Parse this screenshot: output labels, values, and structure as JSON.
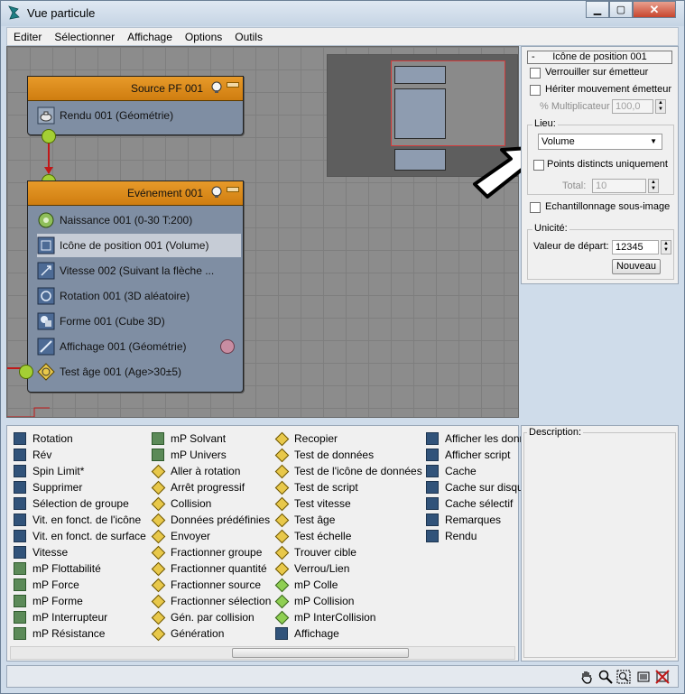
{
  "window": {
    "title": "Vue particule",
    "minimize": "▁",
    "maximize": "▢",
    "close": "✕"
  },
  "menu": [
    "Editer",
    "Sélectionner",
    "Affichage",
    "Options",
    "Outils"
  ],
  "source_node": {
    "title": "Source PF 001",
    "operator": "Rendu 001 (Géométrie)"
  },
  "event_node": {
    "title": "Evénement 001",
    "operators": [
      "Naissance 001 (0-30 T:200)",
      "Icône de position 001 (Volume)",
      "Vitesse 002 (Suivant la flèche ...",
      "Rotation 001 (3D aléatoire)",
      "Forme 001 (Cube 3D)",
      "Affichage 001 (Géométrie)",
      "Test âge 001 (Age>30±5)"
    ],
    "selected_index": 1
  },
  "rollout": {
    "collapse": "-",
    "title": "Icône de position 001",
    "lock_emitter": "Verrouiller sur émetteur",
    "inherit_motion": "Hériter mouvement émetteur",
    "multiplier_label": "% Multiplicateur",
    "multiplier_value": "100,0",
    "lieu_label": "Lieu:",
    "lieu_value": "Volume",
    "distinct_points": "Points distincts uniquement",
    "total_label": "Total:",
    "total_value": "10",
    "subframe": "Echantillonnage sous-image",
    "unicity_label": "Unicité:",
    "seed_label": "Valeur de départ:",
    "seed_value": "12345",
    "new_button": "Nouveau"
  },
  "depot": {
    "columns": [
      [
        "Rotation",
        "Rév",
        "Spin Limit*",
        "Supprimer",
        "Sélection de groupe",
        "Vit. en fonct. de l'icône",
        "Vit. en fonct. de surface",
        "Vitesse",
        "mP Flottabilité",
        "mP Force",
        "mP Forme",
        "mP Interrupteur",
        "mP Résistance"
      ],
      [
        "mP Solvant",
        "mP Univers",
        "Aller à rotation",
        "Arrêt progressif",
        "Collision",
        "Données prédéfinies",
        "Envoyer",
        "Fractionner groupe",
        "Fractionner quantité",
        "Fractionner source",
        "Fractionner sélection",
        "Gén. par collision",
        "Génération"
      ],
      [
        "Recopier",
        "Test de données",
        "Test de l'icône de données",
        "Test de script",
        "Test vitesse",
        "Test âge",
        "Test échelle",
        "Trouver cible",
        "Verrou/Lien",
        "mP Colle",
        "mP Collision",
        "mP InterCollision",
        "Affichage"
      ],
      [
        "Afficher les données",
        "Afficher script",
        "Cache",
        "Cache sur disque",
        "Cache sélectif",
        "Remarques",
        "Rendu"
      ]
    ]
  },
  "description": {
    "label": "Description:"
  }
}
